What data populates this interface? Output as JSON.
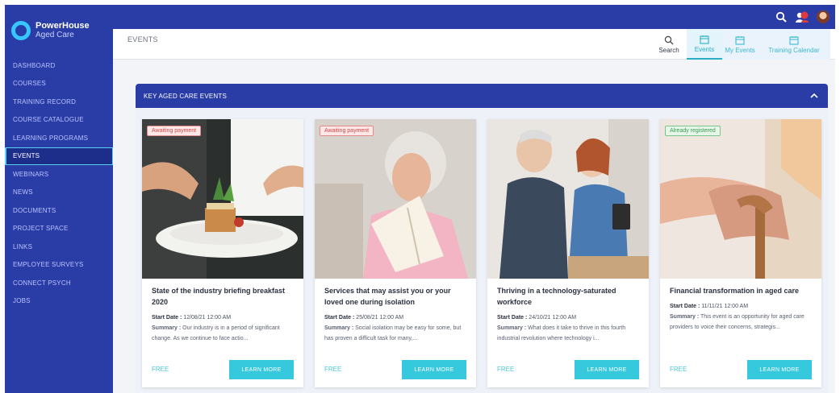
{
  "brand": {
    "line1": "PowerHouse",
    "line2": "Aged Care"
  },
  "sidebar": {
    "items": [
      {
        "label": "DASHBOARD"
      },
      {
        "label": "COURSES"
      },
      {
        "label": "TRAINING RECORD"
      },
      {
        "label": "COURSE CATALOGUE"
      },
      {
        "label": "LEARNING PROGRAMS"
      },
      {
        "label": "EVENTS",
        "active": true
      },
      {
        "label": "WEBINARS"
      },
      {
        "label": "NEWS"
      },
      {
        "label": "DOCUMENTS"
      },
      {
        "label": "PROJECT SPACE"
      },
      {
        "label": "LINKS"
      },
      {
        "label": "EMPLOYEE SURVEYS"
      },
      {
        "label": "CONNECT PSYCH"
      },
      {
        "label": "JOBS"
      }
    ]
  },
  "topbar": {
    "icons": [
      "search-icon",
      "notification-icon",
      "avatar"
    ]
  },
  "header": {
    "title": "EVENTS",
    "tabs": [
      {
        "label": "Search",
        "icon": "search-icon"
      },
      {
        "label": "Events",
        "icon": "calendar-icon",
        "active": true
      },
      {
        "label": "My Events",
        "icon": "calendar-icon"
      },
      {
        "label": "Training Calendar",
        "icon": "calendar-icon"
      }
    ]
  },
  "panel": {
    "title": "KEY AGED CARE EVENTS"
  },
  "events": [
    {
      "badge": "Awaiting payment",
      "title": "State of the industry briefing breakfast 2020",
      "start_label": "Start Date :",
      "start": "12/08/21 12:00 AM",
      "summary_label": "Summary :",
      "summary": "Our industry is in a period of significant change. As we continue to face actio...",
      "price": "FREE",
      "cta": "LEARN MORE",
      "image": "chef plating food"
    },
    {
      "badge": "Awaiting payment",
      "title": "Services that may assist you or your loved one during isolation",
      "start_label": "Start Date :",
      "start": "25/08/21 12:00 AM",
      "summary_label": "Summary :",
      "summary": "Social isolation may be easy for some, but has proven a difficult task for many,...",
      "price": "FREE",
      "cta": "LEARN MORE",
      "image": "elderly woman reading"
    },
    {
      "badge": "",
      "title": "Thriving in a technology-saturated workforce",
      "start_label": "Start Date :",
      "start": "24/10/21 12:00 AM",
      "summary_label": "Summary :",
      "summary": "What does it take to thrive in this fourth industrial revolution where technology i...",
      "price": "FREE",
      "cta": "LEARN MORE",
      "image": "nurse with elderly man and tablet"
    },
    {
      "badge": "Already registered",
      "title": "Financial transformation in aged care",
      "start_label": "Start Date :",
      "start": "11/11/21 12:00 AM",
      "summary_label": "Summary :",
      "summary": "This event is an opportunity for aged care providers to voice their concerns, strategis...",
      "price": "FREE",
      "cta": "LEARN MORE",
      "image": "hands on walking cane"
    }
  ],
  "colors": {
    "navy": "#2a3ca6",
    "accent": "#36c8dc",
    "pay_badge": "#d1484a",
    "reg_badge": "#3c9b50"
  }
}
